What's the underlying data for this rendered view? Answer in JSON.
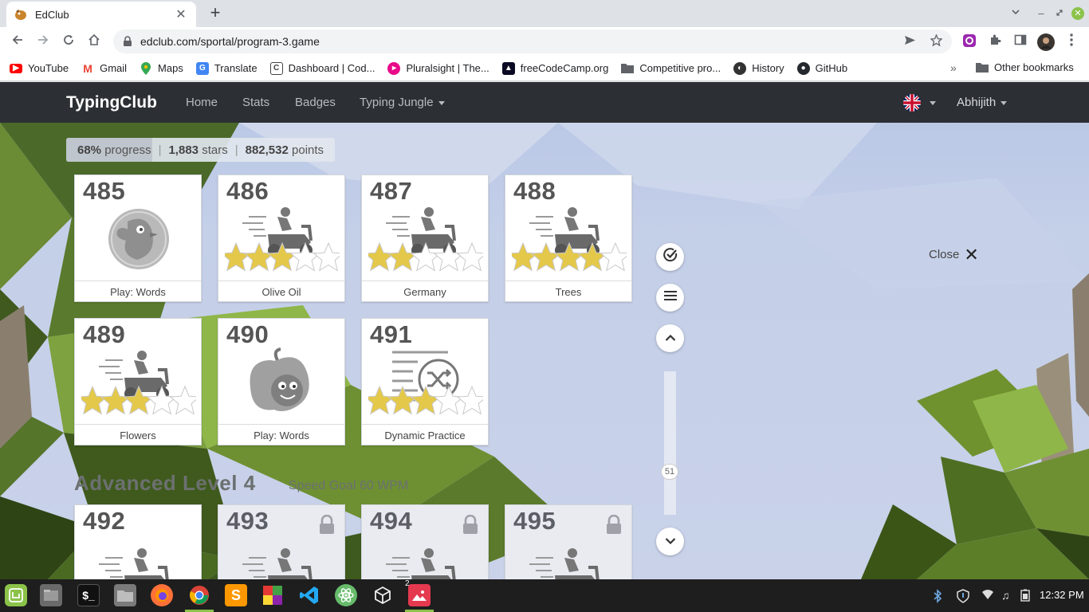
{
  "browser": {
    "tab_title": "EdClub",
    "tab_close": "✕",
    "new_tab": "+",
    "url": "edclub.com/sportal/program-3.game",
    "bookmarks": [
      {
        "label": "YouTube",
        "icon": "youtube-icon",
        "color": "#ff0000"
      },
      {
        "label": "Gmail",
        "icon": "gmail-icon",
        "color": "#ea4335"
      },
      {
        "label": "Maps",
        "icon": "maps-icon",
        "color": "#34a853"
      },
      {
        "label": "Translate",
        "icon": "translate-icon",
        "color": "#4285f4"
      },
      {
        "label": "Dashboard | Cod...",
        "icon": "dashboard-icon",
        "color": "#444444"
      },
      {
        "label": "Pluralsight | The...",
        "icon": "pluralsight-icon",
        "color": "#e80a89"
      },
      {
        "label": "freeCodeCamp.org",
        "icon": "freecodecamp-icon",
        "color": "#0a0a23"
      },
      {
        "label": "Competitive pro...",
        "icon": "folder-icon",
        "color": "#5f6368"
      },
      {
        "label": "History",
        "icon": "history-icon",
        "color": "#333333"
      },
      {
        "label": "GitHub",
        "icon": "github-icon",
        "color": "#24292e"
      }
    ],
    "bookmarks_more": "»",
    "other_bookmarks": "Other bookmarks"
  },
  "site": {
    "brand": "TypingClub",
    "nav": [
      "Home",
      "Stats",
      "Badges",
      "Typing Jungle"
    ],
    "user": "Abhijith"
  },
  "stats": {
    "progress_percent": 68,
    "progress_value": "68%",
    "progress_label": "progress",
    "stars_value": "1,883",
    "stars_label": "stars",
    "points_value": "882,532",
    "points_label": "points"
  },
  "lessons": [
    {
      "number": "485",
      "label": "Play: Words",
      "type": "game-bird",
      "stars": null,
      "locked": false
    },
    {
      "number": "486",
      "label": "Olive Oil",
      "type": "scooter",
      "stars": 3,
      "locked": false
    },
    {
      "number": "487",
      "label": "Germany",
      "type": "scooter",
      "stars": 2,
      "locked": false
    },
    {
      "number": "488",
      "label": "Trees",
      "type": "scooter",
      "stars": 4,
      "locked": false
    },
    {
      "number": "489",
      "label": "Flowers",
      "type": "scooter",
      "stars": 3,
      "locked": false
    },
    {
      "number": "490",
      "label": "Play: Words",
      "type": "game-apple",
      "stars": null,
      "locked": false
    },
    {
      "number": "491",
      "label": "Dynamic Practice",
      "type": "shuffle",
      "stars": 3,
      "locked": false
    }
  ],
  "next_level": {
    "title": "Advanced Level 4",
    "subtitle": "Speed Goal 60 WPM",
    "lessons": [
      {
        "number": "492",
        "locked": false
      },
      {
        "number": "493",
        "locked": true
      },
      {
        "number": "494",
        "locked": true
      },
      {
        "number": "495",
        "locked": true
      }
    ]
  },
  "side_controls": {
    "scroll_label": "51"
  },
  "close_label": "Close",
  "close_icon": "✕",
  "taskbar": {
    "clock": "12:32 PM",
    "badge": "2",
    "apps": [
      "mint-menu-icon",
      "files-icon",
      "terminal-icon",
      "folder-icon",
      "firefox-icon",
      "chrome-icon",
      "sublime-icon",
      "multicolor-app-icon",
      "vscode-icon",
      "atom-icon",
      "unity-icon",
      "image-viewer-icon"
    ]
  },
  "colors": {
    "navbar_bg": "#2c2f33",
    "star_gold": "#e4c84a",
    "star_empty": "#ffffff",
    "mint_green": "#8bc34a"
  }
}
